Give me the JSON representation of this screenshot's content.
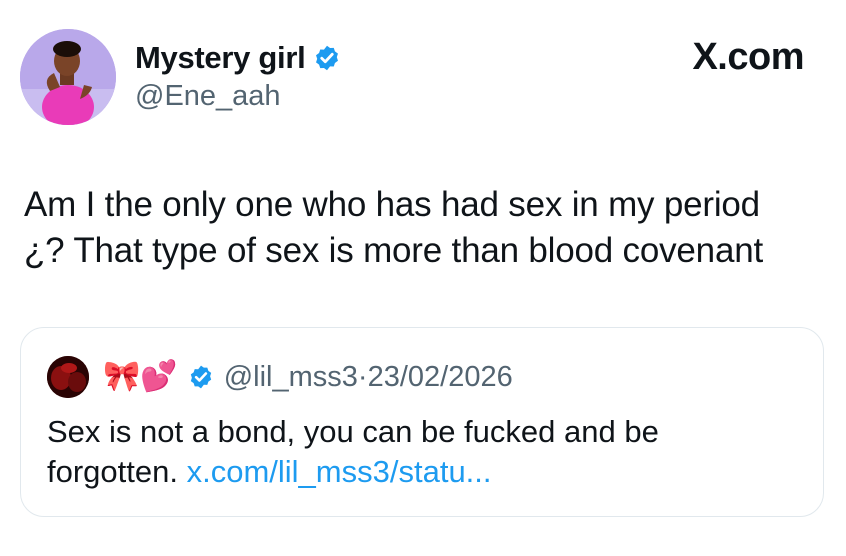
{
  "author": {
    "display_name": "Mystery girl",
    "handle": "@Ene_aah",
    "verified_icon": "verified-badge-icon"
  },
  "brand": "X.com",
  "tweet": {
    "line1": "Am I the only one who has had sex in my period",
    "line2": "¿? That type of sex is more than blood covenant"
  },
  "quote": {
    "display_name": "🎀💕",
    "handle": "@lil_mss3",
    "separator": "·",
    "date": "23/02/2026",
    "line1": "Sex is not a bond, you can be fucked and be",
    "line2_text": "forgotten.",
    "link": "x.com/lil_mss3/statu..."
  },
  "colors": {
    "verified_blue": "#1d9bf0",
    "secondary_text": "#536471",
    "link": "#1d9bf0"
  }
}
